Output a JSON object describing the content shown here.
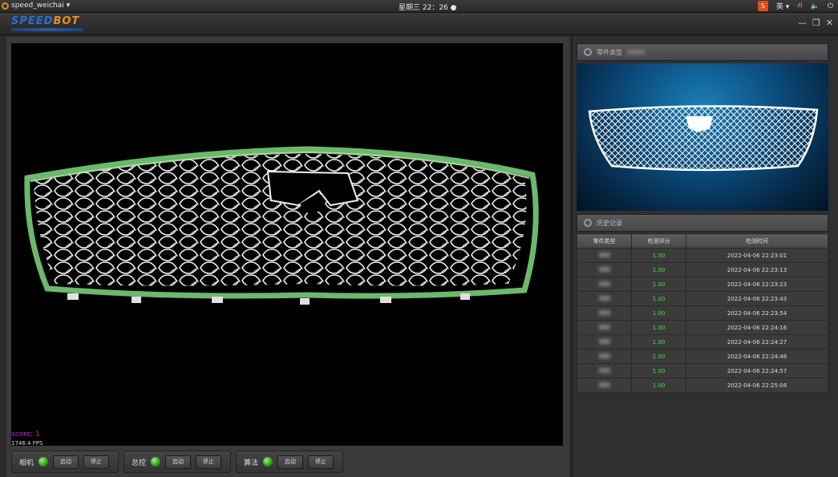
{
  "sysbar": {
    "app_name": "speed_weichai",
    "clock": "星期三 22：26",
    "lang": "英",
    "tray_app": "S"
  },
  "logo": {
    "part_a": "SPEED",
    "part_b": "BOT"
  },
  "viewer": {
    "score": "score: 1",
    "fps": "1746.4 FPS"
  },
  "controls": [
    {
      "label": "相机",
      "start": "启动",
      "stop": "停止"
    },
    {
      "label": "总控",
      "start": "启动",
      "stop": "停止"
    },
    {
      "label": "算法",
      "start": "启动",
      "stop": "停止"
    }
  ],
  "part_panel": {
    "title": "零件类型"
  },
  "history_panel": {
    "title": "历史记录",
    "columns": [
      "零件类型",
      "检测评分",
      "检测时间"
    ],
    "rows": [
      {
        "score": "1.00",
        "time": "2022-04-06 22:23:01"
      },
      {
        "score": "1.00",
        "time": "2022-04-06 22:23:13"
      },
      {
        "score": "1.00",
        "time": "2022-04-06 22:23:23"
      },
      {
        "score": "1.00",
        "time": "2022-04-06 22:23:43"
      },
      {
        "score": "1.00",
        "time": "2022-04-06 22:23:54"
      },
      {
        "score": "1.00",
        "time": "2022-04-06 22:24:16"
      },
      {
        "score": "1.00",
        "time": "2022-04-06 22:24:27"
      },
      {
        "score": "1.00",
        "time": "2022-04-06 22:24:46"
      },
      {
        "score": "1.00",
        "time": "2022-04-06 22:24:57"
      },
      {
        "score": "1.00",
        "time": "2022-04-06 22:25:08"
      }
    ]
  },
  "colors": {
    "score_good": "#3ee03e",
    "score_text": "#d020d0",
    "logo_blue": "#2b6fd6",
    "logo_orange": "#e8901a"
  }
}
